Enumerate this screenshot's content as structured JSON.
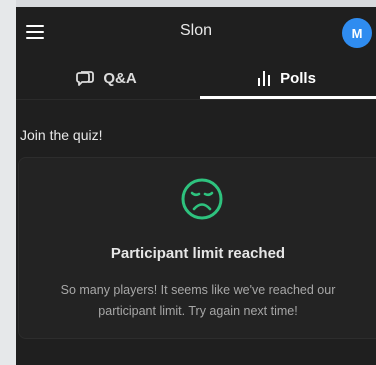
{
  "header": {
    "title": "Slon",
    "avatar_initial": "M",
    "menu_icon": "hamburger-menu-icon"
  },
  "tabs": [
    {
      "label": "Q&A",
      "icon": "chat-bubble-icon",
      "active": false
    },
    {
      "label": "Polls",
      "icon": "bar-chart-icon",
      "active": true
    }
  ],
  "main": {
    "section_label": "Join the quiz!",
    "card": {
      "icon": "sad-face-icon",
      "title": "Participant limit reached",
      "message": "So many players! It seems like we've reached our participant limit. Try again next time!"
    }
  },
  "colors": {
    "background": "#1f1f1f",
    "accent_green": "#2ec27e",
    "avatar_blue": "#2f8cf0"
  }
}
